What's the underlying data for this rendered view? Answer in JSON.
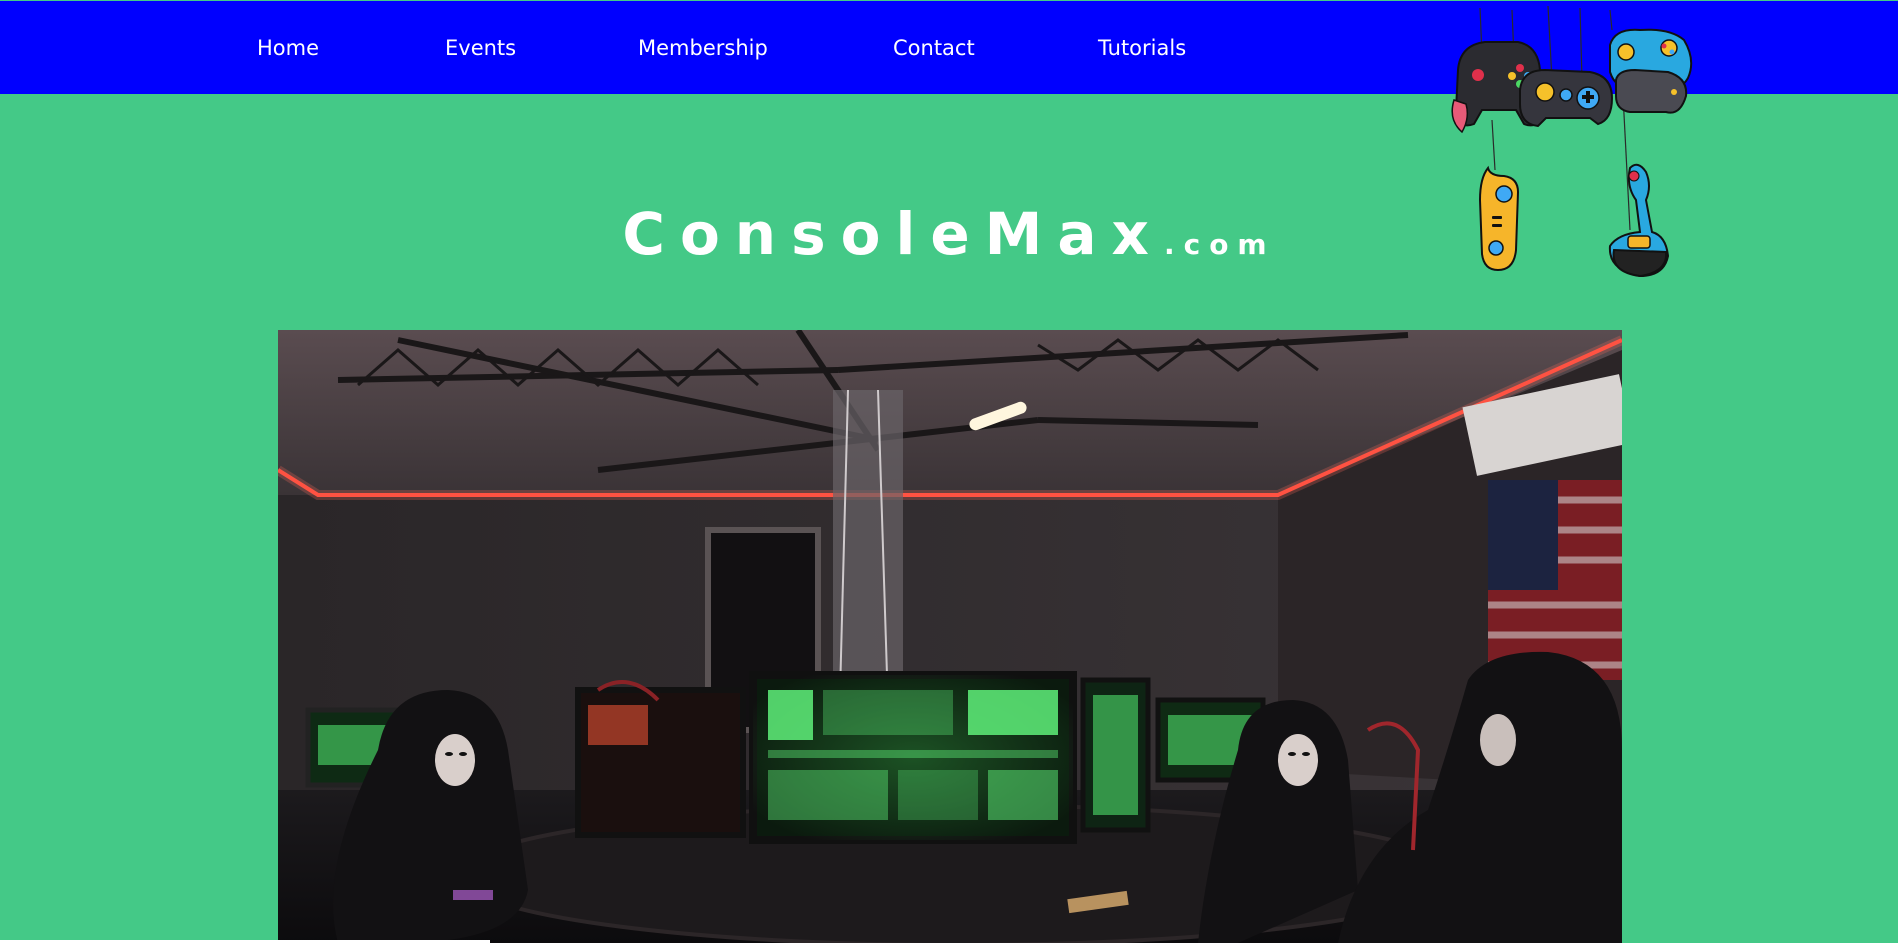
{
  "nav": {
    "items": [
      {
        "label": "Home"
      },
      {
        "label": "Events"
      },
      {
        "label": "Membership"
      },
      {
        "label": "Contact"
      },
      {
        "label": "Tutorials"
      }
    ]
  },
  "logo": {
    "main": "ConsoleMax",
    "tld": ".com"
  },
  "decoration": {
    "icon": "hanging-game-controllers-icon"
  },
  "hero": {
    "icon": "gaming-room-photo"
  },
  "colors": {
    "nav_background": "#0000ff",
    "page_background": "#44c987",
    "text": "#ffffff"
  }
}
